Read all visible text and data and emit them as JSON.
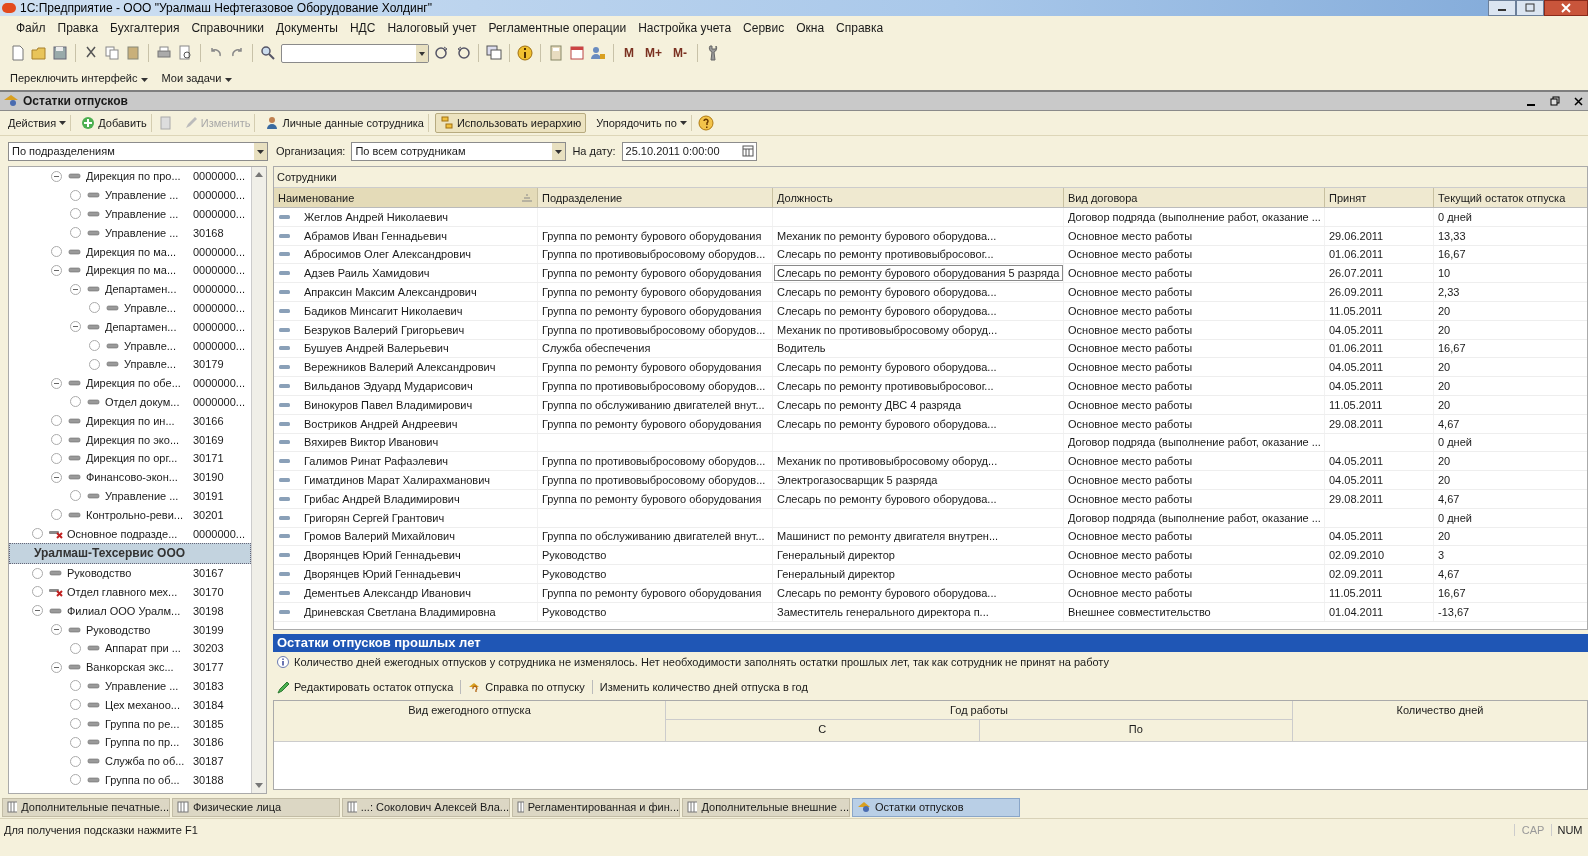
{
  "window": {
    "title": "1С:Предприятие - ООО \"Уралмаш Нефтегазовое Оборудование Холдинг\""
  },
  "menu": [
    "Файл",
    "Правка",
    "Бухгалтерия",
    "Справочники",
    "Документы",
    "НДС",
    "Налоговый учет",
    "Регламентные операции",
    "Настройка учета",
    "Сервис",
    "Окна",
    "Справка"
  ],
  "toolbar": {
    "memory_buttons": [
      "M",
      "M+",
      "M-"
    ]
  },
  "panel_bar": [
    "Переключить интерфейс",
    "Мои задачи"
  ],
  "document": {
    "title": "Остатки отпусков",
    "actions": [
      {
        "label": "Действия",
        "kind": "menu",
        "disabled": false,
        "pressed": false
      },
      {
        "label": "Добавить",
        "kind": "add",
        "disabled": false,
        "pressed": false
      },
      {
        "label": "Изменить",
        "kind": "edit",
        "disabled": true,
        "pressed": false
      },
      {
        "label": "Личные данные сотрудника",
        "kind": "person",
        "disabled": false,
        "pressed": false
      },
      {
        "label": "Использовать иерархию",
        "kind": "hierarchy",
        "disabled": false,
        "pressed": true
      },
      {
        "label": "Упорядочить по",
        "kind": "menu",
        "disabled": false,
        "pressed": false
      }
    ],
    "grouping": "По подразделениям",
    "organization_label": "Организация:",
    "organization": "По всем сотрудникам",
    "date_label": "На дату:",
    "date": "25.10.2011  0:00:00"
  },
  "tree": [
    {
      "kind": "offscreen",
      "children": [
        {
          "kind": "offscreen",
          "children": [
            {
              "name": "Дирекция по про...",
              "code": "0000000...",
              "kind": "unit",
              "expanded": true,
              "selected": false,
              "children": [
                {
                  "name": "Управление ...",
                  "code": "0000000...",
                  "kind": "unit",
                  "expanded": false,
                  "selected": false
                },
                {
                  "name": "Управление ...",
                  "code": "0000000...",
                  "kind": "unit",
                  "expanded": false,
                  "selected": false
                },
                {
                  "name": "Управление ...",
                  "code": "30168",
                  "kind": "unit",
                  "expanded": false,
                  "selected": false
                }
              ]
            },
            {
              "name": "Дирекция по ма...",
              "code": "0000000...",
              "kind": "unit",
              "expanded": false,
              "selected": false
            },
            {
              "name": "Дирекция по ма...",
              "code": "0000000...",
              "kind": "unit",
              "expanded": true,
              "selected": false,
              "children": [
                {
                  "name": "Департамен...",
                  "code": "0000000...",
                  "kind": "unit",
                  "expanded": true,
                  "selected": false,
                  "children": [
                    {
                      "name": "Управле...",
                      "code": "0000000...",
                      "kind": "unit",
                      "expanded": false,
                      "selected": false
                    }
                  ]
                },
                {
                  "name": "Департамен...",
                  "code": "0000000...",
                  "kind": "unit",
                  "expanded": true,
                  "selected": false,
                  "children": [
                    {
                      "name": "Управле...",
                      "code": "0000000...",
                      "kind": "unit",
                      "expanded": false,
                      "selected": false
                    },
                    {
                      "name": "Управле...",
                      "code": "30179",
                      "kind": "unit",
                      "expanded": false,
                      "selected": false
                    }
                  ]
                }
              ]
            },
            {
              "name": "Дирекция по обе...",
              "code": "0000000...",
              "kind": "unit",
              "expanded": true,
              "selected": false,
              "children": [
                {
                  "name": "Отдел докум...",
                  "code": "0000000...",
                  "kind": "unit",
                  "expanded": false,
                  "selected": false
                }
              ]
            },
            {
              "name": "Дирекция по ин...",
              "code": "30166",
              "kind": "unit",
              "expanded": false,
              "selected": false
            },
            {
              "name": "Дирекция по эко...",
              "code": "30169",
              "kind": "unit",
              "expanded": false,
              "selected": false
            },
            {
              "name": "Дирекция по орг...",
              "code": "30171",
              "kind": "unit",
              "expanded": false,
              "selected": false
            },
            {
              "name": "Финансово-экон...",
              "code": "30190",
              "kind": "unit",
              "expanded": true,
              "selected": false,
              "children": [
                {
                  "name": "Управление ...",
                  "code": "30191",
                  "kind": "unit",
                  "expanded": false,
                  "selected": false
                }
              ]
            },
            {
              "name": "Контрольно-реви...",
              "code": "30201",
              "kind": "unit",
              "expanded": false,
              "selected": false
            }
          ]
        },
        {
          "name": "Основное подразде...",
          "code": "0000000...",
          "kind": "deleted",
          "expanded": false,
          "selected": false
        }
      ]
    },
    {
      "name": "Уралмаш-Техсервис ООО",
      "kind": "org",
      "selected": true,
      "children": [
        {
          "name": "Руководство",
          "code": "30167",
          "kind": "unit",
          "expanded": false,
          "selected": false
        },
        {
          "name": "Отдел главного мех...",
          "code": "30170",
          "kind": "deleted",
          "expanded": false,
          "selected": false
        },
        {
          "name": "Филиал ООО Уралм...",
          "code": "30198",
          "kind": "unit",
          "expanded": true,
          "selected": false,
          "children": [
            {
              "name": "Руководство",
              "code": "30199",
              "kind": "unit",
              "expanded": true,
              "selected": false,
              "children": [
                {
                  "name": "Аппарат при ...",
                  "code": "30203",
                  "kind": "unit",
                  "expanded": false,
                  "selected": false
                }
              ]
            },
            {
              "name": "Ванкорская экс...",
              "code": "30177",
              "kind": "unit",
              "expanded": true,
              "selected": false,
              "children": [
                {
                  "name": "Управление ...",
                  "code": "30183",
                  "kind": "unit",
                  "expanded": false,
                  "selected": false
                },
                {
                  "name": "Цех механоо...",
                  "code": "30184",
                  "kind": "unit",
                  "expanded": false,
                  "selected": false
                },
                {
                  "name": "Группа по ре...",
                  "code": "30185",
                  "kind": "unit",
                  "expanded": false,
                  "selected": false
                },
                {
                  "name": "Группа по пр...",
                  "code": "30186",
                  "kind": "unit",
                  "expanded": false,
                  "selected": false
                },
                {
                  "name": "Служба по об...",
                  "code": "30187",
                  "kind": "unit",
                  "expanded": false,
                  "selected": false
                },
                {
                  "name": "Группа по об...",
                  "code": "30188",
                  "kind": "unit",
                  "expanded": false,
                  "selected": false
                }
              ]
            }
          ]
        }
      ]
    }
  ],
  "employees": {
    "caption": "Сотрудники",
    "columns": [
      {
        "label": "Наименование",
        "sorted": true
      },
      {
        "label": "Подразделение",
        "sorted": false
      },
      {
        "label": "Должность",
        "sorted": false
      },
      {
        "label": "Вид договора",
        "sorted": false
      },
      {
        "label": "Принят",
        "sorted": false
      },
      {
        "label": "Текущий остаток отпуска",
        "sorted": false
      }
    ],
    "rows": [
      {
        "name": "Жеглов Андрей Николаевич",
        "department": "",
        "position": "",
        "contract": "Договор подряда (выполнение работ, оказание ...",
        "hired": "",
        "balance": "0 дней",
        "selected": false
      },
      {
        "name": "Абрамов Иван Геннадьевич",
        "department": "Группа по ремонту бурового оборудования",
        "position": "Механик по ремонту бурового оборудова...",
        "contract": "Основное место работы",
        "hired": "29.06.2011",
        "balance": "13,33",
        "selected": false
      },
      {
        "name": "Абросимов Олег Александрович",
        "department": "Группа по противовыбросовому оборудов...",
        "position": "Слесарь по ремонту противовыбросовог...",
        "contract": "Основное место работы",
        "hired": "01.06.2011",
        "balance": "16,67",
        "selected": false
      },
      {
        "name": "Адзев Раиль Хамидович",
        "department": "Группа по ремонту бурового оборудования",
        "position": "Слесарь по ремонту бурового оборудования 5 разряда",
        "contract": "Основное место работы",
        "hired": "26.07.2011",
        "balance": "10",
        "selected": true
      },
      {
        "name": "Апраксин Максим Александрович",
        "department": "Группа по ремонту бурового оборудования",
        "position": "Слесарь по ремонту бурового оборудова...",
        "contract": "Основное место работы",
        "hired": "26.09.2011",
        "balance": "2,33",
        "selected": false
      },
      {
        "name": "Бадиков Минсагит Николаевич",
        "department": "Группа по ремонту бурового оборудования",
        "position": "Слесарь по ремонту бурового оборудова...",
        "contract": "Основное место работы",
        "hired": "11.05.2011",
        "balance": "20",
        "selected": false
      },
      {
        "name": "Безруков Валерий Григорьевич",
        "department": "Группа по противовыбросовому оборудов...",
        "position": "Механик по противовыбросовому оборуд...",
        "contract": "Основное место работы",
        "hired": "04.05.2011",
        "balance": "20",
        "selected": false
      },
      {
        "name": "Бушуев Андрей Валерьевич",
        "department": "Служба обеспечения",
        "position": "Водитель",
        "contract": "Основное место работы",
        "hired": "01.06.2011",
        "balance": "16,67",
        "selected": false
      },
      {
        "name": "Вережников Валерий Александрович",
        "department": "Группа по ремонту бурового оборудования",
        "position": "Слесарь по ремонту бурового оборудова...",
        "contract": "Основное место работы",
        "hired": "04.05.2011",
        "balance": "20",
        "selected": false
      },
      {
        "name": "Вильданов Эдуард Мударисович",
        "department": "Группа по противовыбросовому оборудов...",
        "position": "Слесарь по ремонту противовыбросовог...",
        "contract": "Основное место работы",
        "hired": "04.05.2011",
        "balance": "20",
        "selected": false
      },
      {
        "name": "Винокуров Павел Владимирович",
        "department": "Группа по обслуживанию двигателей внут...",
        "position": "Слесарь по ремонту ДВС 4 разряда",
        "contract": "Основное место работы",
        "hired": "11.05.2011",
        "balance": "20",
        "selected": false
      },
      {
        "name": "Востриков Андрей Андреевич",
        "department": "Группа по ремонту бурового оборудования",
        "position": "Слесарь по ремонту бурового оборудова...",
        "contract": "Основное место работы",
        "hired": "29.08.2011",
        "balance": "4,67",
        "selected": false
      },
      {
        "name": "Вяхирев Виктор Иванович",
        "department": "",
        "position": "",
        "contract": "Договор подряда (выполнение работ, оказание ...",
        "hired": "",
        "balance": "0 дней",
        "selected": false
      },
      {
        "name": "Галимов Ринат Рафаэлевич",
        "department": "Группа по противовыбросовому оборудов...",
        "position": "Механик по противовыбросовому оборуд...",
        "contract": "Основное место работы",
        "hired": "04.05.2011",
        "balance": "20",
        "selected": false
      },
      {
        "name": "Гиматдинов Марат Халирахманович",
        "department": "Группа по противовыбросовому оборудов...",
        "position": "Электрогазосварщик 5 разряда",
        "contract": "Основное место работы",
        "hired": "04.05.2011",
        "balance": "20",
        "selected": false
      },
      {
        "name": "Грибас Андрей Владимирович",
        "department": "Группа по ремонту бурового оборудования",
        "position": "Слесарь по ремонту бурового оборудова...",
        "contract": "Основное место работы",
        "hired": "29.08.2011",
        "balance": "4,67",
        "selected": false
      },
      {
        "name": "Григорян Сергей Грантович",
        "department": "",
        "position": "",
        "contract": "Договор подряда (выполнение работ, оказание ...",
        "hired": "",
        "balance": "0 дней",
        "selected": false
      },
      {
        "name": "Громов Валерий Михайлович",
        "department": "Группа по обслуживанию двигателей внут...",
        "position": "Машинист по ремонту двигателя внутрен...",
        "contract": "Основное место работы",
        "hired": "04.05.2011",
        "balance": "20",
        "selected": false
      },
      {
        "name": "Дворянцев Юрий Геннадьевич",
        "department": "Руководство",
        "position": "Генеральный директор",
        "contract": "Основное место работы",
        "hired": "02.09.2010",
        "balance": "3",
        "selected": false
      },
      {
        "name": "Дворянцев Юрий Геннадьевич",
        "department": "Руководство",
        "position": "Генеральный директор",
        "contract": "Основное место работы",
        "hired": "02.09.2011",
        "balance": "4,67",
        "selected": false
      },
      {
        "name": "Дементьев Александр Иванович",
        "department": "Группа по ремонту бурового оборудования",
        "position": "Слесарь по ремонту бурового оборудова...",
        "contract": "Основное место работы",
        "hired": "11.05.2011",
        "balance": "16,67",
        "selected": false
      },
      {
        "name": "Дриневская Светлана Владимировна",
        "department": "Руководство",
        "position": "Заместитель генерального директора п...",
        "contract": "Внешнее совместительство",
        "hired": "01.04.2011",
        "balance": "-13,67",
        "selected": false
      }
    ]
  },
  "past_years": {
    "title": "Остатки отпусков прошлых лет",
    "info": "Количество дней ежегодных отпусков у сотрудника не изменялось. Нет необходимости заполнять остатки прошлых лет, так как сотрудник не принят на работу",
    "actions": [
      {
        "label": "Редактировать остаток отпуска",
        "kind": "edit"
      },
      {
        "label": "Справка по отпуску",
        "kind": "help"
      },
      {
        "label": "Изменить количество дней отпуска в год",
        "kind": "plain"
      }
    ],
    "columns": {
      "type": "Вид ежегодного отпуска",
      "year": "Год работы",
      "from": "С",
      "to": "По",
      "days": "Количество дней"
    }
  },
  "taskbar": [
    {
      "label": "Дополнительные печатные...",
      "selected": false
    },
    {
      "label": "Физические лица",
      "selected": false
    },
    {
      "label": "...: Соколович Алексей Вла...",
      "selected": false
    },
    {
      "label": "Регламентированная и фин...",
      "selected": false
    },
    {
      "label": "Дополнительные внешние ...",
      "selected": false
    },
    {
      "label": "Остатки отпусков",
      "selected": true
    }
  ],
  "status_bar": {
    "hint": "Для получения подсказки нажмите F1",
    "indicators": [
      "CAP",
      "NUM"
    ]
  }
}
